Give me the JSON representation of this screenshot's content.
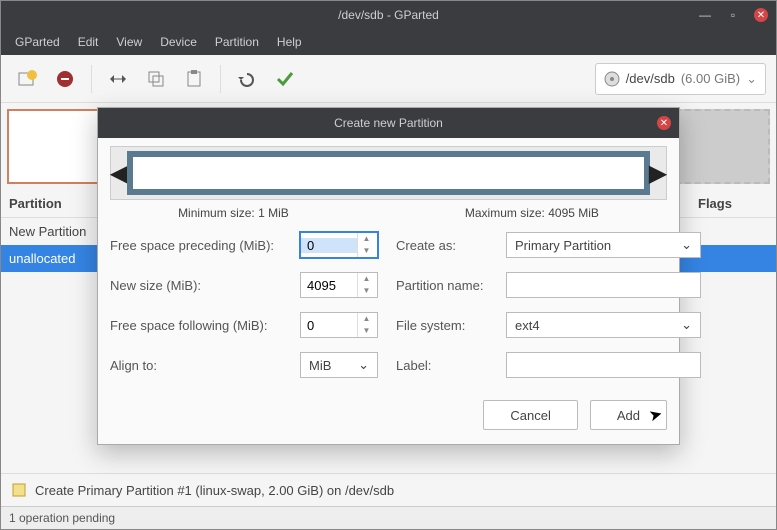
{
  "window": {
    "title": "/dev/sdb - GParted"
  },
  "menubar": {
    "items": [
      "GParted",
      "Edit",
      "View",
      "Device",
      "Partition",
      "Help"
    ]
  },
  "toolbar": {
    "device_text": "/dev/sdb",
    "device_size": "(6.00 GiB)"
  },
  "table": {
    "headers": {
      "partition": "Partition",
      "flags": "Flags"
    },
    "rows": [
      {
        "name": "New Partition",
        "selected": false
      },
      {
        "name": "unallocated",
        "selected": true
      }
    ]
  },
  "pending": {
    "icon": "note-icon",
    "text": "Create Primary Partition #1 (linux-swap, 2.00 GiB) on /dev/sdb"
  },
  "statusbar": {
    "text": "1 operation pending"
  },
  "dialog": {
    "title": "Create new Partition",
    "min_size": "Minimum size: 1 MiB",
    "max_size": "Maximum size: 4095 MiB",
    "left_fields": {
      "free_preceding": {
        "label": "Free space preceding (MiB):",
        "value": "0"
      },
      "new_size": {
        "label": "New size (MiB):",
        "value": "4095"
      },
      "free_following": {
        "label": "Free space following (MiB):",
        "value": "0"
      },
      "align_to": {
        "label": "Align to:",
        "value": "MiB"
      }
    },
    "right_fields": {
      "create_as": {
        "label": "Create as:",
        "value": "Primary Partition"
      },
      "partition_name": {
        "label": "Partition name:",
        "value": ""
      },
      "file_system": {
        "label": "File system:",
        "value": "ext4"
      },
      "fs_label": {
        "label": "Label:",
        "value": ""
      }
    },
    "buttons": {
      "cancel": "Cancel",
      "add": "Add"
    }
  }
}
